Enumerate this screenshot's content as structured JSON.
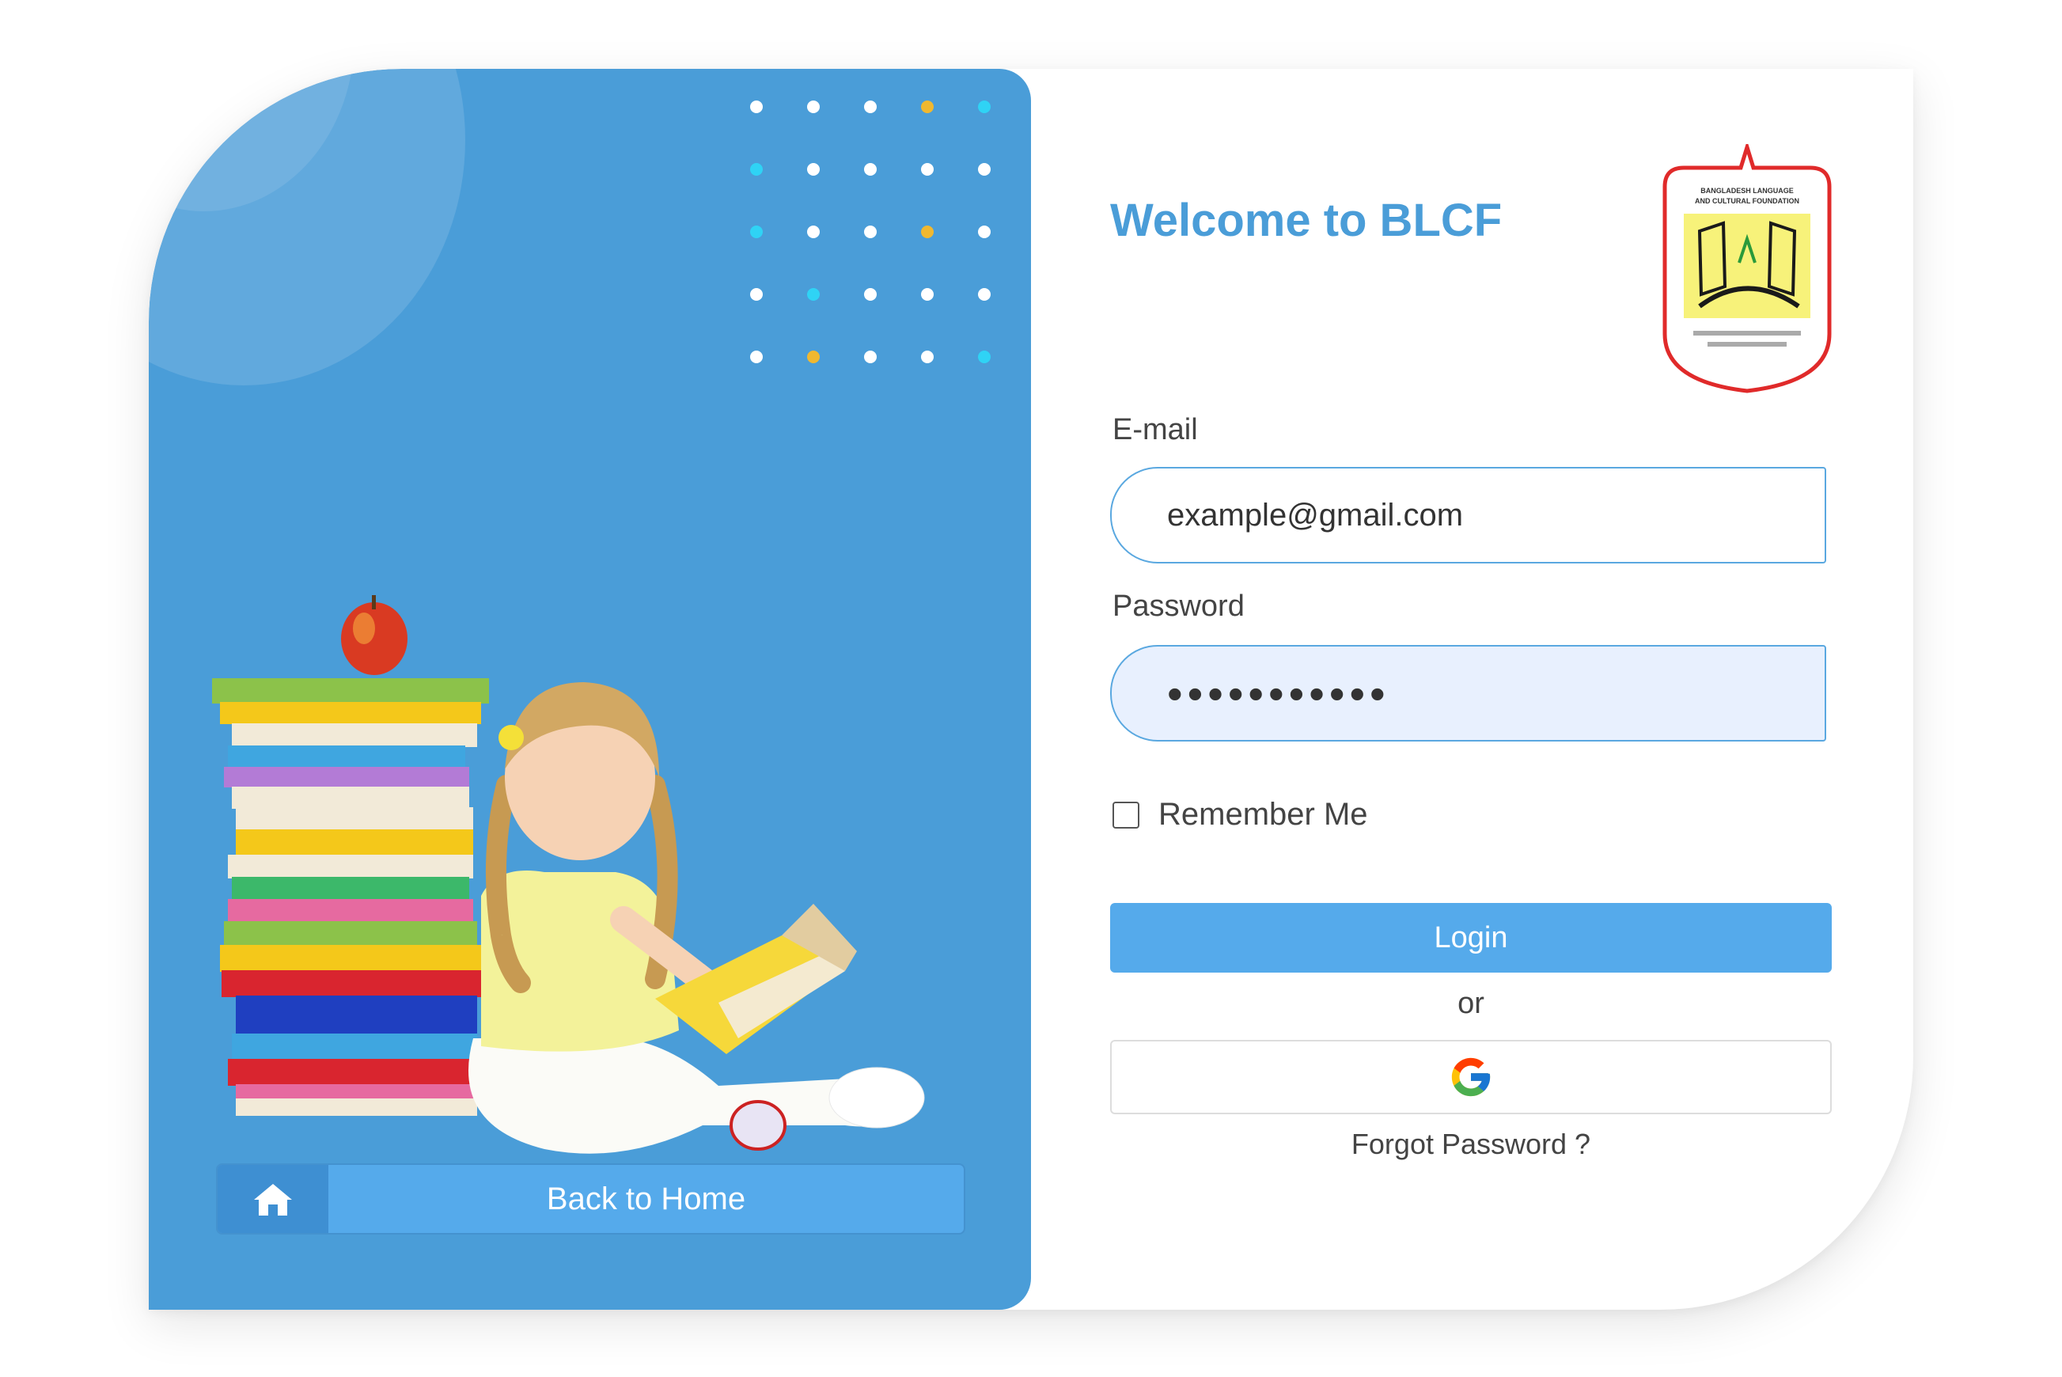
{
  "sidebar": {
    "back_home_label": "Back to Home",
    "home_icon": "home-icon"
  },
  "form": {
    "welcome_title": "Welcome to BLCF",
    "email_label": "E-mail",
    "email_value": "example@gmail.com",
    "password_label": "Password",
    "password_value": "•••••••••••",
    "remember_label": "Remember Me",
    "remember_checked": false,
    "login_label": "Login",
    "or_label": "or",
    "google_icon": "google-icon",
    "forgot_label": "Forgot Password ?"
  },
  "logo": {
    "name": "blcf-logo",
    "top_text_1": "BANGLADESH LANGUAGE",
    "top_text_2": "AND CULTURAL FOUNDATION"
  },
  "colors": {
    "primary_blue": "#4a9dd8",
    "button_blue": "#55aaeb",
    "dot_white": "#ffffff",
    "dot_cyan": "#2fd3f5",
    "dot_yellow": "#f0b830"
  },
  "dot_colors": [
    [
      "w",
      "w",
      "w",
      "y",
      "c"
    ],
    [
      "c",
      "w",
      "w",
      "w",
      "w"
    ],
    [
      "c",
      "w",
      "w",
      "y",
      "w"
    ],
    [
      "w",
      "c",
      "w",
      "w",
      "w"
    ],
    [
      "w",
      "y",
      "w",
      "w",
      "c"
    ]
  ]
}
